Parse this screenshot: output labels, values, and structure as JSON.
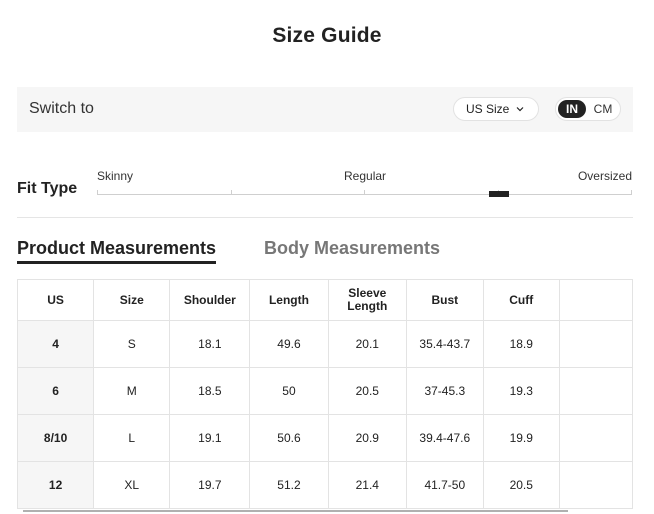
{
  "page_title": "Size Guide",
  "switch_bar": {
    "label": "Switch to",
    "size_select": "US Size",
    "units": {
      "selected": "IN",
      "other": "CM"
    }
  },
  "fit_type": {
    "label": "Fit Type",
    "options": [
      "Skinny",
      "Regular",
      "Oversized"
    ]
  },
  "tabs": {
    "product": "Product Measurements",
    "body": "Body Measurements",
    "active": "product"
  },
  "table": {
    "headers": [
      "US",
      "Size",
      "Shoulder",
      "Length",
      "Sleeve Length",
      "Bust",
      "Cuff",
      ""
    ],
    "rows": [
      [
        "4",
        "S",
        "18.1",
        "49.6",
        "20.1",
        "35.4-43.7",
        "18.9",
        ""
      ],
      [
        "6",
        "M",
        "18.5",
        "50",
        "20.5",
        "37-45.3",
        "19.3",
        ""
      ],
      [
        "8/10",
        "L",
        "19.1",
        "50.6",
        "20.9",
        "39.4-47.6",
        "19.9",
        ""
      ],
      [
        "12",
        "XL",
        "19.7",
        "51.2",
        "21.4",
        "41.7-50",
        "20.5",
        ""
      ]
    ]
  },
  "colors": {
    "accent": "#222222",
    "panel": "#f6f6f6",
    "muted_tab": "#777777"
  }
}
